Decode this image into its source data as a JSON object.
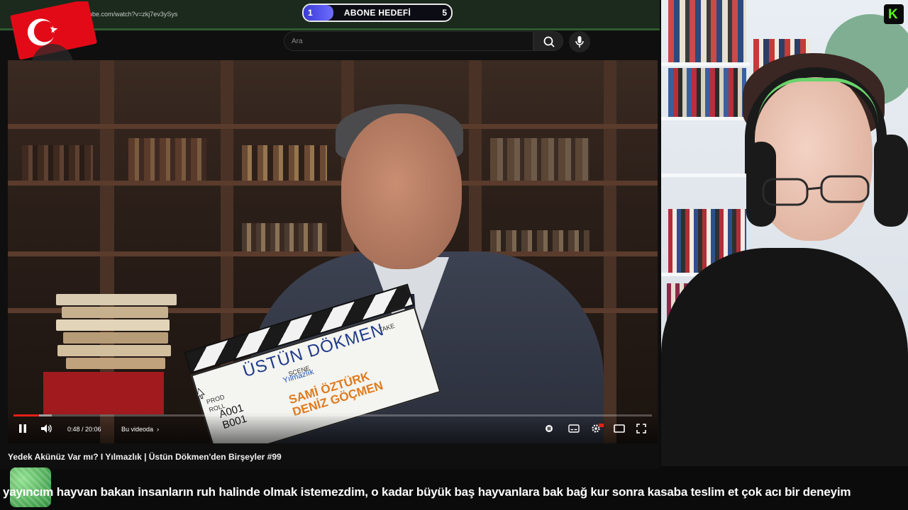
{
  "browser": {
    "url": "youtube.com/watch?v=zkj7ev3ySys"
  },
  "sub_goal": {
    "title": "ABONE HEDEFİ",
    "current": "1",
    "target": "5",
    "progress": 0.2
  },
  "youtube": {
    "search_placeholder": "Ara"
  },
  "video": {
    "clapper_name": "ÜSTÜN DÖKMEN",
    "clapper_scene_label": "SCENE",
    "clapper_take_label": "TAKE",
    "clapper_prod_label": "PROD",
    "clapper_roll_label": "ROLL",
    "clapper_roll": "A001\nB001",
    "clapper_title": "Yılmazlık",
    "clapper_cast": "SAMİ ÖZTÜRK\nDENİZ GÖÇMEN",
    "title": "Yedek Akünüz Var mı? I Yılmazlık | Üstün Dökmen'den Birşeyler #99"
  },
  "player": {
    "time": "0:48 / 20:06",
    "chapter": "Bu videoda",
    "progress": 0.04,
    "buffered": 0.06
  },
  "caption": {
    "text": "yayıncım hayvan bakan insanların ruh halinde olmak istemezdim, o kadar büyük baş hayvanlara bak bağ kur sonra kasaba teslim et çok acı bir deneyim"
  },
  "icons": {
    "flag": "turkey-flag-icon",
    "kick": "kick-logo-icon",
    "search": "search-icon",
    "mic": "mic-icon",
    "pause": "pause-icon",
    "volume": "volume-icon",
    "settings": "gear-icon",
    "subtitles": "subtitles-icon",
    "theater": "theater-icon",
    "fullscreen": "fullscreen-icon"
  },
  "colors": {
    "progress_red": "#e62117",
    "subgoal_fill": "#4b4bff",
    "kick_green": "#53fc18"
  }
}
